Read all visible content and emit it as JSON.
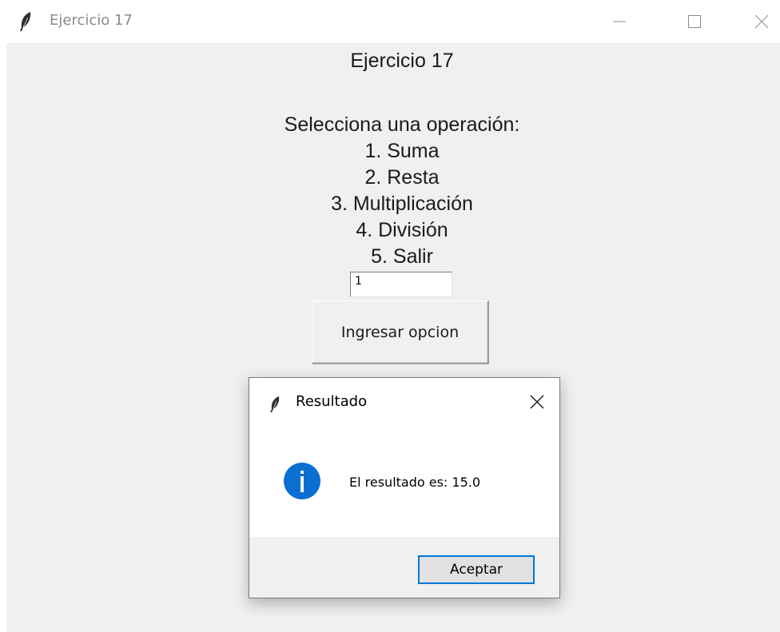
{
  "window": {
    "title": "Ejercicio 17"
  },
  "main": {
    "heading": "Ejercicio 17",
    "menu_lines": [
      "Selecciona una operación:",
      "1. Suma",
      "2. Resta",
      "3. Multiplicación",
      "4. División",
      "5. Salir"
    ],
    "entry_value": "1",
    "submit_label": "Ingresar opcion"
  },
  "dialog": {
    "title": "Resultado",
    "message": "El resultado es: 15.0",
    "ok_label": "Aceptar",
    "icon": "info-icon"
  },
  "colors": {
    "accent": "#0078d7",
    "client_bg": "#f0f0f0"
  }
}
